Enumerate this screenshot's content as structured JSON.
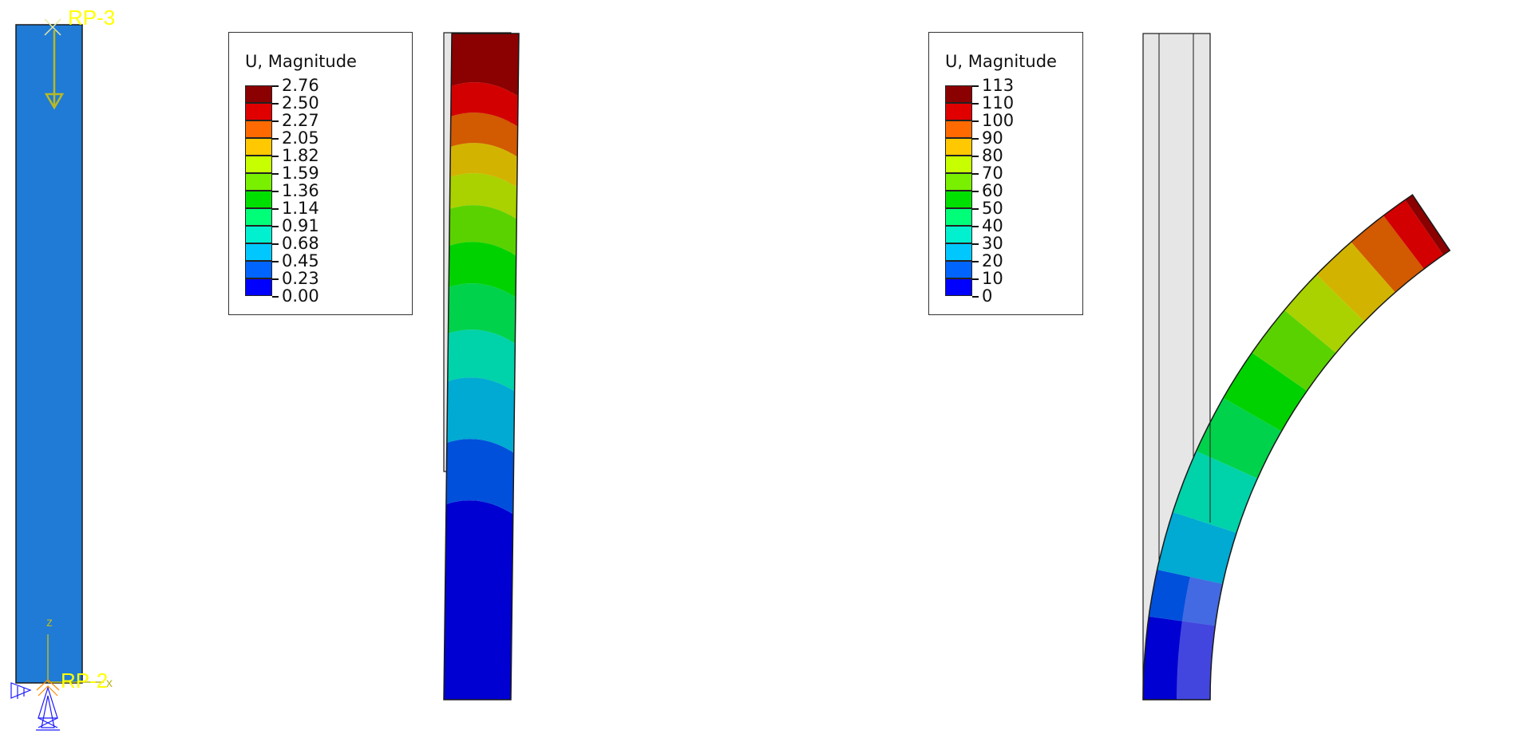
{
  "views": {
    "undeformed": {
      "reference_points": {
        "top": "RP-3",
        "bottom": "RP-2"
      },
      "triad_axes": {
        "vertical": "z",
        "horizontal": "x"
      },
      "part_color": "#1f7bd6",
      "load_color": "#b9b923",
      "label_color": "#ffff00"
    },
    "contour_1": {
      "legend": {
        "title": "U, Magnitude",
        "values": [
          "2.76",
          "2.50",
          "2.27",
          "2.05",
          "1.82",
          "1.59",
          "1.36",
          "1.14",
          "0.91",
          "0.68",
          "0.45",
          "0.23",
          "0.00"
        ]
      }
    },
    "contour_2": {
      "legend": {
        "title": "U, Magnitude",
        "values": [
          "113",
          "110",
          "100",
          "90",
          "80",
          "70",
          "60",
          "50",
          "40",
          "30",
          "20",
          "10",
          "0"
        ]
      }
    }
  },
  "legend_colors": [
    "#8b0000",
    "#e00000",
    "#ff6a00",
    "#ffc800",
    "#c8ff00",
    "#78f000",
    "#00e000",
    "#00ff78",
    "#00f0d0",
    "#00c8ff",
    "#0064ff",
    "#0000ff"
  ],
  "band_colors_bottom_to_top": [
    "#0000d2",
    "#0050dc",
    "#00aad2",
    "#00d2aa",
    "#00d24b",
    "#00d200",
    "#5ad200",
    "#aad200",
    "#d2b400",
    "#d25a00",
    "#d20000",
    "#8b0000"
  ],
  "undeformed_ghost_color": "#e6e6e6"
}
